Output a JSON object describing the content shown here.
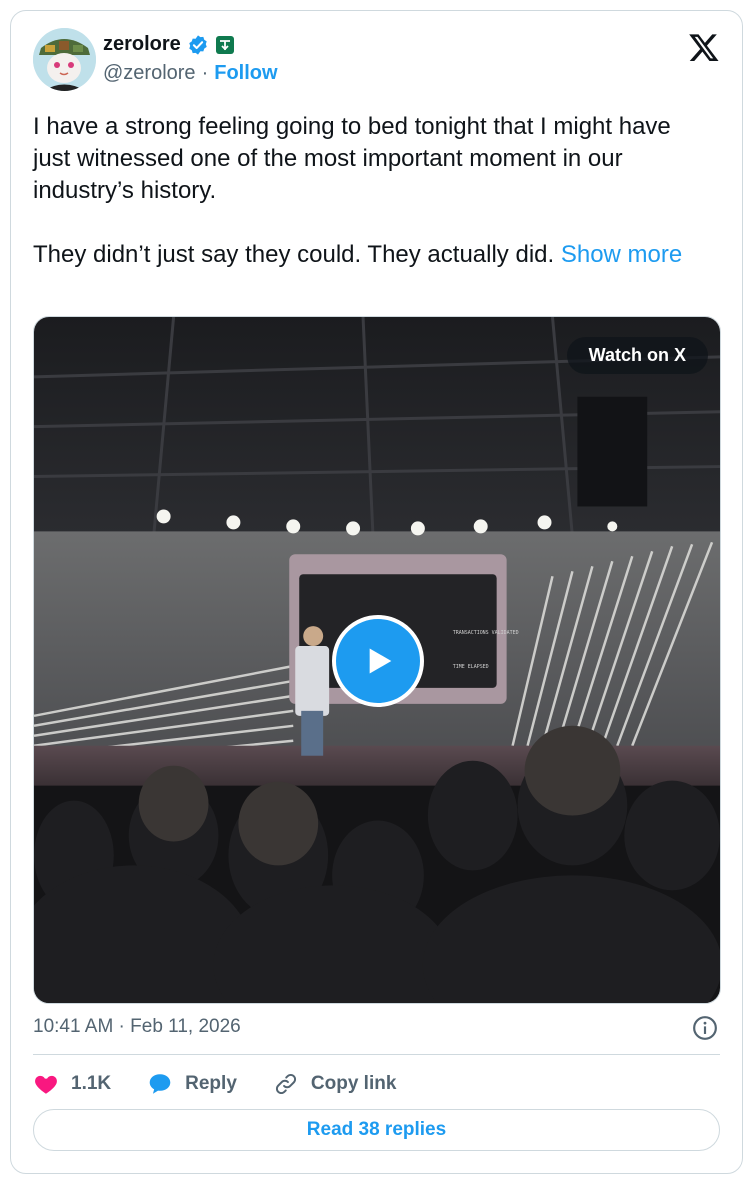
{
  "author": {
    "display_name": "zerolore",
    "handle": "@zerolore",
    "separator": "·",
    "follow_label": "Follow",
    "verified": true
  },
  "tweet": {
    "paragraph1": "I have a strong feeling going to bed tonight that I might have just witnessed one of the most important moment in our industry’s history.",
    "paragraph2": "They didn’t just say they could. They actually did.",
    "show_more": "Show more"
  },
  "media": {
    "watch_label": "Watch on X",
    "screen_text_line1": "TRANSACTIONS VALIDATED",
    "screen_text_line2": "TIME ELAPSED"
  },
  "meta": {
    "timestamp": "10:41 AM · Feb 11, 2026"
  },
  "actions": {
    "like_count": "1.1K",
    "reply_label": "Reply",
    "copy_link_label": "Copy link"
  },
  "footer": {
    "read_replies_label": "Read 38 replies"
  },
  "colors": {
    "accent": "#1d9bf0",
    "like": "#f91880",
    "text": "#0f1419",
    "muted": "#536471",
    "border": "#cfd9de"
  }
}
